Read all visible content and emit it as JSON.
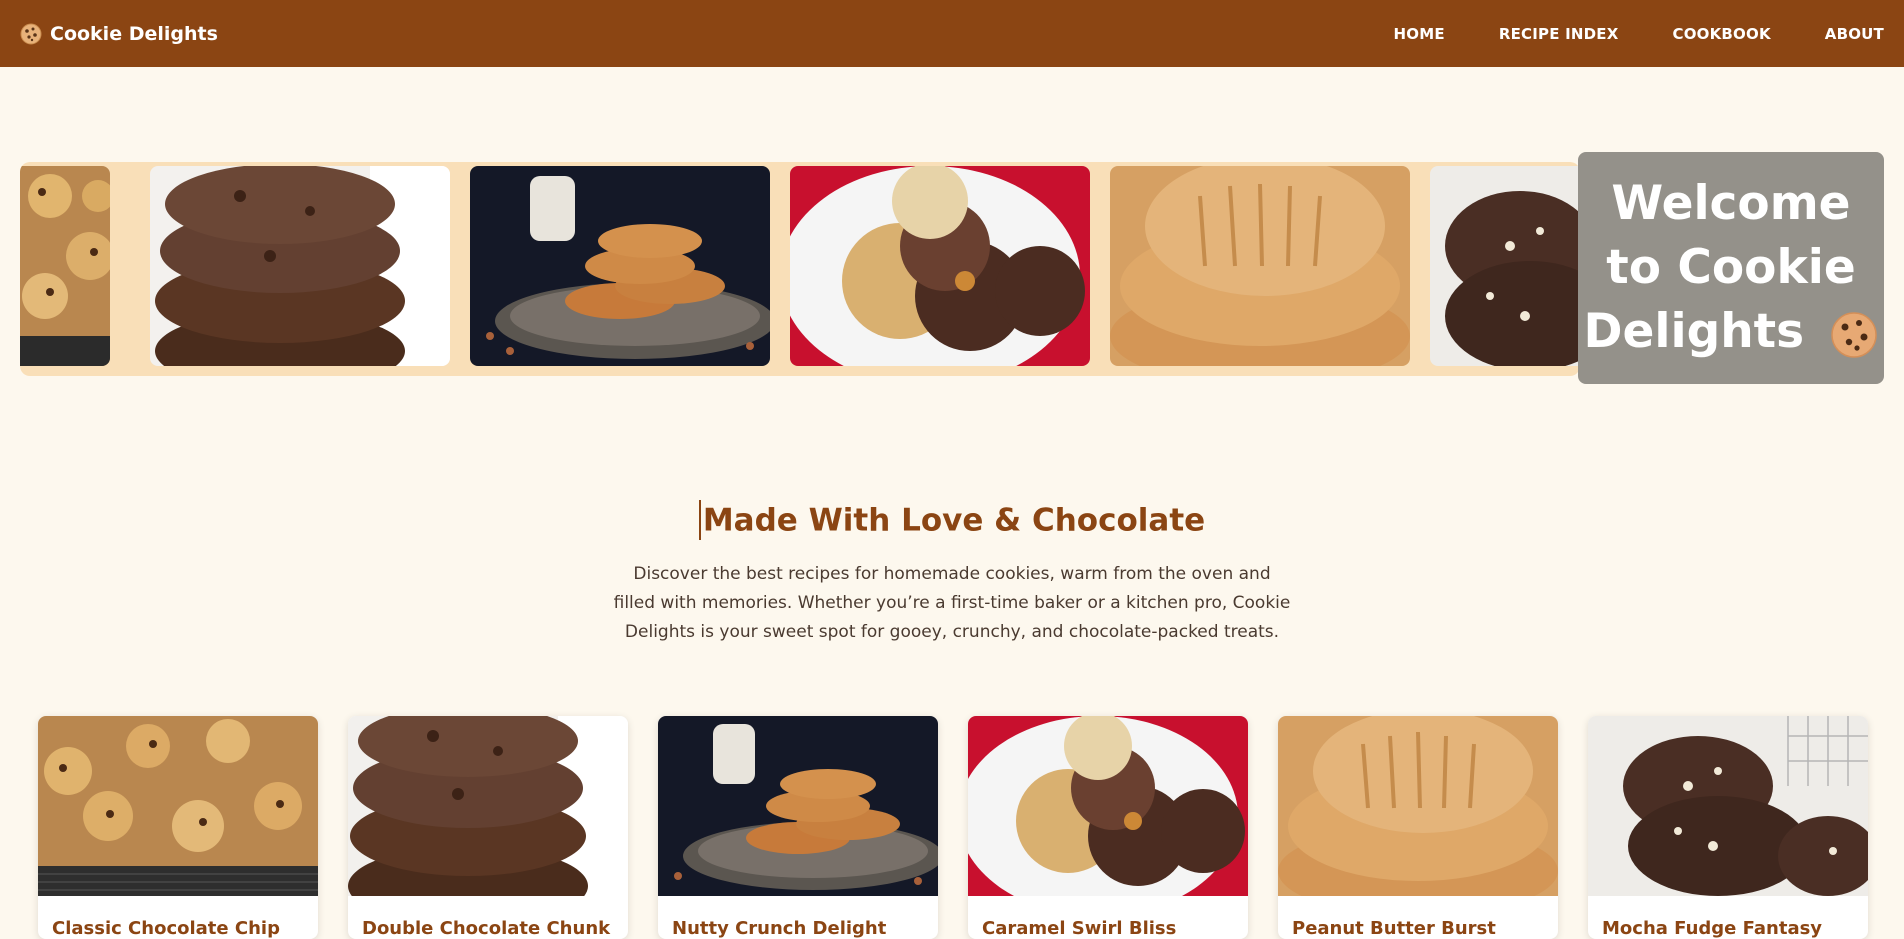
{
  "nav": {
    "brand": "Cookie Delights",
    "brand_icon": "cookie-icon",
    "links": [
      "HOME",
      "RECIPE INDEX",
      "COOKBOOK",
      "ABOUT"
    ]
  },
  "hero": {
    "welcome_line1": "Welcome",
    "welcome_line2": "to Cookie",
    "welcome_line3": "Delights",
    "welcome_icon": "cookie-emoji-icon"
  },
  "intro": {
    "title": "Made With Love & Chocolate",
    "description": "Discover the best recipes for homemade cookies, warm from the oven and filled with memories. Whether you’re a first-time baker or a kitchen pro, Cookie Delights is your sweet spot for gooey, crunchy, and chocolate-packed treats."
  },
  "recipes": [
    {
      "title": "Classic Chocolate Chip"
    },
    {
      "title": "Double Chocolate Chunk"
    },
    {
      "title": "Nutty Crunch Delight"
    },
    {
      "title": "Caramel Swirl Bliss"
    },
    {
      "title": "Peanut Butter Burst"
    },
    {
      "title": "Mocha Fudge Fantasy"
    }
  ],
  "colors": {
    "brand": "#8b4513",
    "background": "#fdf8ee",
    "carousel_band": "#f9dfb8",
    "welcome_box": "#94918a"
  }
}
